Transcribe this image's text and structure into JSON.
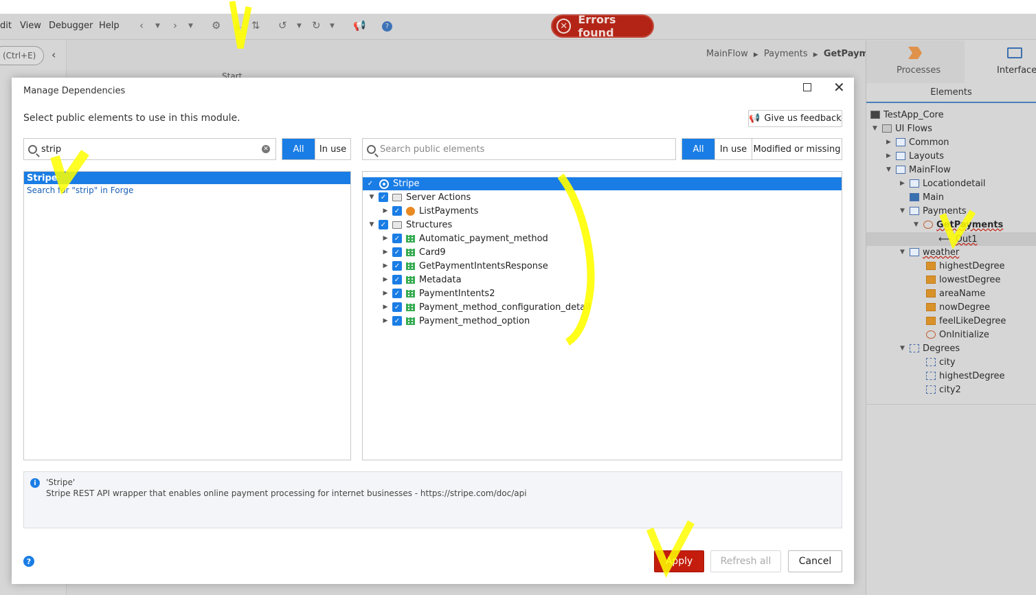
{
  "menubar": {
    "items": [
      "dit",
      "View",
      "Debugger",
      "Help"
    ],
    "errors_badge": "Errors found"
  },
  "left_panel": {
    "search_hint": "(Ctrl+E)"
  },
  "canvas": {
    "start_label": "Start",
    "breadcrumb": [
      "MainFlow",
      "Payments",
      "GetPayments"
    ]
  },
  "right_panel": {
    "tabs": [
      "Processes",
      "Interface"
    ],
    "section_tab": "Elements",
    "tree": [
      {
        "label": "TestApp_Core"
      },
      {
        "label": "UI Flows"
      },
      {
        "label": "Common"
      },
      {
        "label": "Layouts"
      },
      {
        "label": "MainFlow"
      },
      {
        "label": "Locationdetail"
      },
      {
        "label": "Main"
      },
      {
        "label": "Payments"
      },
      {
        "label": "GetPayments"
      },
      {
        "label": "Out1"
      },
      {
        "label": "weather"
      },
      {
        "label": "highestDegree"
      },
      {
        "label": "lowestDegree"
      },
      {
        "label": "areaName"
      },
      {
        "label": "nowDegree"
      },
      {
        "label": "feelLikeDegree"
      },
      {
        "label": "OnInitialize"
      },
      {
        "label": "Degrees"
      },
      {
        "label": "city"
      },
      {
        "label": "highestDegree"
      },
      {
        "label": "city2"
      }
    ]
  },
  "dialog": {
    "title": "Manage Dependencies",
    "subtitle": "Select public elements to use in this module.",
    "feedback_button": "Give us feedback",
    "left": {
      "search_value": "strip",
      "filters": [
        "All",
        "In use"
      ],
      "results": [
        "Stripe"
      ],
      "forge_link": "Search for \"strip\" in Forge"
    },
    "right": {
      "search_placeholder": "Search public elements",
      "filters": [
        "All",
        "In use",
        "Modified or missing"
      ],
      "tree": [
        {
          "label": "Stripe"
        },
        {
          "label": "Server Actions"
        },
        {
          "label": "ListPayments"
        },
        {
          "label": "Structures"
        },
        {
          "label": "Automatic_payment_method"
        },
        {
          "label": "Card9"
        },
        {
          "label": "GetPaymentIntentsResponse"
        },
        {
          "label": "Metadata"
        },
        {
          "label": "PaymentIntents2"
        },
        {
          "label": "Payment_method_configuration_detail"
        },
        {
          "label": "Payment_method_option"
        }
      ]
    },
    "info": {
      "name": "'Stripe'",
      "description": "Stripe REST API wrapper that enables online payment processing for internet businesses - https://stripe.com/doc/api"
    },
    "buttons": {
      "apply": "Apply",
      "refresh": "Refresh all",
      "cancel": "Cancel"
    }
  },
  "colors": {
    "accent": "#1a7de5",
    "apply": "#c41d0d",
    "error_badge": "#b32416",
    "annotation": "#ffff00"
  }
}
